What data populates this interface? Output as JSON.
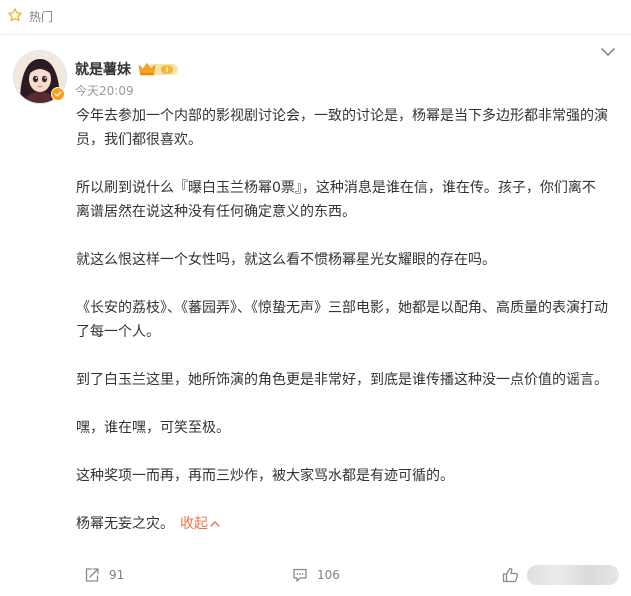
{
  "section": {
    "label": "热门",
    "icon": "star-icon"
  },
  "post": {
    "author": "就是薯妹",
    "badge_icon": "vip-crown-badge-icon",
    "verified_icon": "verified-icon",
    "time": "今天20:09",
    "paragraphs": [
      "今年去参加一个内部的影视剧讨论会，一致的讨论是，杨幂是当下多边形都非常强的演员，我们都很喜欢。",
      "所以刷到说什么『曝白玉兰杨幂0票』，这种消息是谁在信，谁在传。孩子，你们离不离谱居然在说这种没有任何确定意义的东西。",
      "就这么恨这样一个女性吗，就这么看不惯杨幂星光女耀眼的存在吗。",
      "《长安的荔枝》、《蕃园弄》、《惊蛰无声》三部电影，她都是以配角、高质量的表演打动了每一个人。",
      "到了白玉兰这里，她所饰演的角色更是非常好，到底是谁传播这种没一点价值的谣言。",
      "嘿，谁在嘿，可笑至极。",
      "这种奖项一而再，再而三炒作，被大家骂水都是有迹可循的。"
    ],
    "last_paragraph": "杨幂无妄之灾。",
    "collapse_label": "收起"
  },
  "actions": {
    "repost_count": "91",
    "comment_count": "106"
  },
  "colors": {
    "accent": "#eb7350",
    "badge": "#f7a11a",
    "muted": "#808080"
  }
}
